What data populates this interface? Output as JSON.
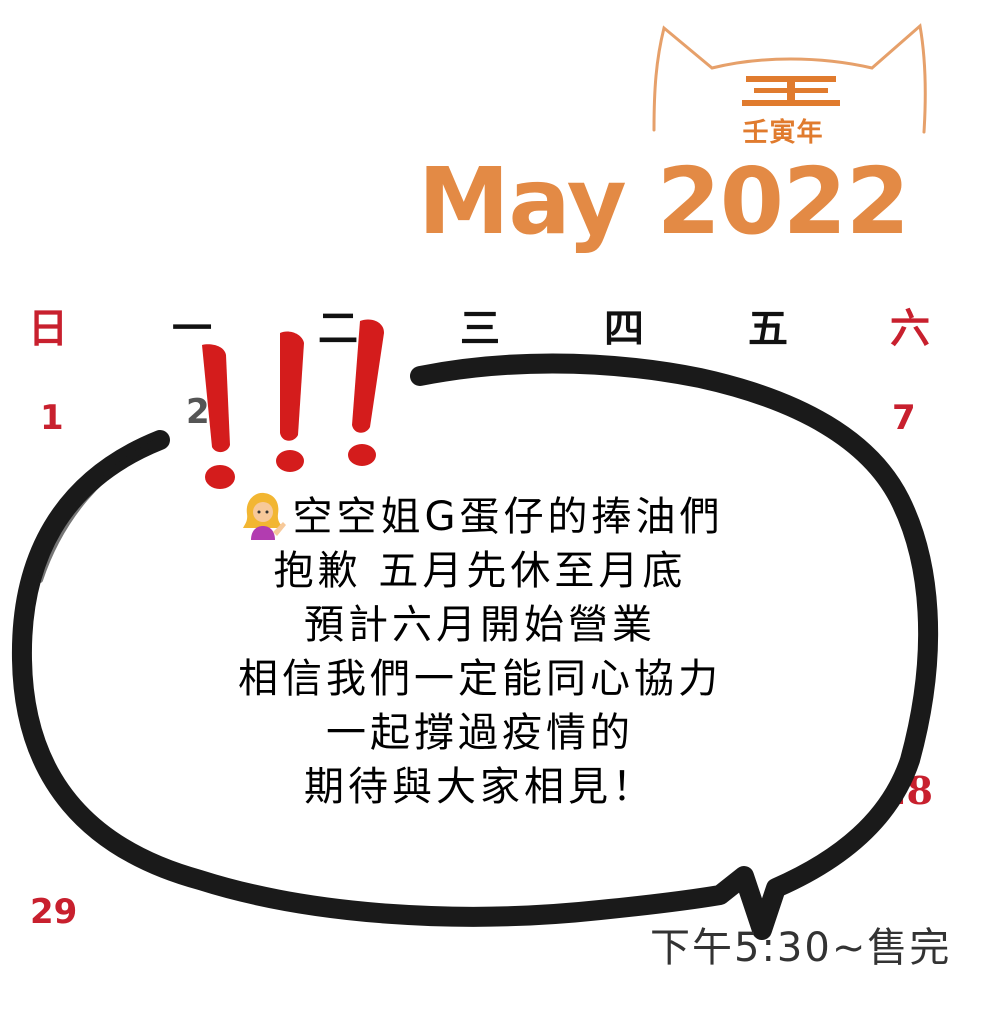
{
  "header": {
    "era": "壬寅年",
    "month_title": "May 2022"
  },
  "weekdays": [
    "日",
    "一",
    "二",
    "三",
    "四",
    "五",
    "六"
  ],
  "visible_days": {
    "d1": "1",
    "d2": "2",
    "d7": "7",
    "d28": "28",
    "d29": "29"
  },
  "bubble": {
    "exclamation": "!!!",
    "emoji": "person-tipping-hand-icon",
    "lines": [
      "空空姐G蛋仔的捧油們",
      "抱歉 五月先休至月底",
      "預計六月開始營業",
      "相信我們一定能同心協力",
      "一起撐過疫情的",
      "期待與大家相見！"
    ]
  },
  "hours": "下午5:30~售完",
  "colors": {
    "title_orange": "#e38a45",
    "accent_red": "#c8202e",
    "exclaim_red": "#d41c1c",
    "bubble_stroke": "#1a1a1a"
  }
}
